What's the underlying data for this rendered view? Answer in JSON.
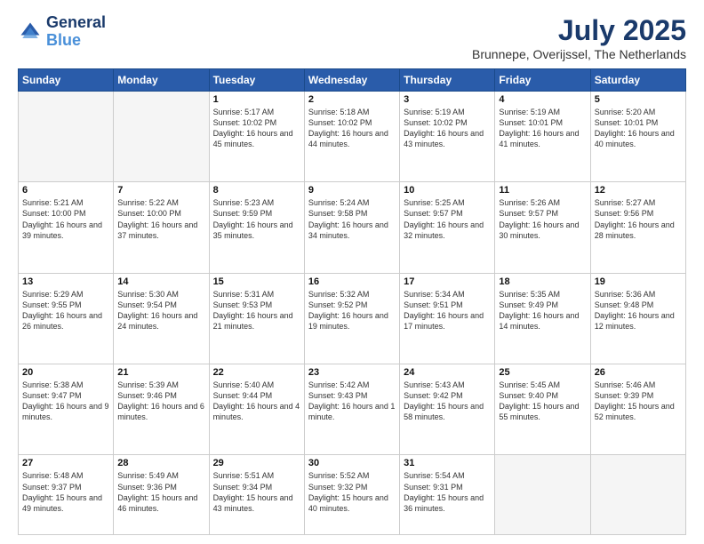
{
  "logo": {
    "line1": "General",
    "line2": "Blue"
  },
  "header": {
    "month": "July 2025",
    "location": "Brunnepe, Overijssel, The Netherlands"
  },
  "weekdays": [
    "Sunday",
    "Monday",
    "Tuesday",
    "Wednesday",
    "Thursday",
    "Friday",
    "Saturday"
  ],
  "weeks": [
    [
      {
        "day": "",
        "info": "",
        "empty": true
      },
      {
        "day": "",
        "info": "",
        "empty": true
      },
      {
        "day": "1",
        "info": "Sunrise: 5:17 AM\nSunset: 10:02 PM\nDaylight: 16 hours\nand 45 minutes."
      },
      {
        "day": "2",
        "info": "Sunrise: 5:18 AM\nSunset: 10:02 PM\nDaylight: 16 hours\nand 44 minutes."
      },
      {
        "day": "3",
        "info": "Sunrise: 5:19 AM\nSunset: 10:02 PM\nDaylight: 16 hours\nand 43 minutes."
      },
      {
        "day": "4",
        "info": "Sunrise: 5:19 AM\nSunset: 10:01 PM\nDaylight: 16 hours\nand 41 minutes."
      },
      {
        "day": "5",
        "info": "Sunrise: 5:20 AM\nSunset: 10:01 PM\nDaylight: 16 hours\nand 40 minutes."
      }
    ],
    [
      {
        "day": "6",
        "info": "Sunrise: 5:21 AM\nSunset: 10:00 PM\nDaylight: 16 hours\nand 39 minutes."
      },
      {
        "day": "7",
        "info": "Sunrise: 5:22 AM\nSunset: 10:00 PM\nDaylight: 16 hours\nand 37 minutes."
      },
      {
        "day": "8",
        "info": "Sunrise: 5:23 AM\nSunset: 9:59 PM\nDaylight: 16 hours\nand 35 minutes."
      },
      {
        "day": "9",
        "info": "Sunrise: 5:24 AM\nSunset: 9:58 PM\nDaylight: 16 hours\nand 34 minutes."
      },
      {
        "day": "10",
        "info": "Sunrise: 5:25 AM\nSunset: 9:57 PM\nDaylight: 16 hours\nand 32 minutes."
      },
      {
        "day": "11",
        "info": "Sunrise: 5:26 AM\nSunset: 9:57 PM\nDaylight: 16 hours\nand 30 minutes."
      },
      {
        "day": "12",
        "info": "Sunrise: 5:27 AM\nSunset: 9:56 PM\nDaylight: 16 hours\nand 28 minutes."
      }
    ],
    [
      {
        "day": "13",
        "info": "Sunrise: 5:29 AM\nSunset: 9:55 PM\nDaylight: 16 hours\nand 26 minutes."
      },
      {
        "day": "14",
        "info": "Sunrise: 5:30 AM\nSunset: 9:54 PM\nDaylight: 16 hours\nand 24 minutes."
      },
      {
        "day": "15",
        "info": "Sunrise: 5:31 AM\nSunset: 9:53 PM\nDaylight: 16 hours\nand 21 minutes."
      },
      {
        "day": "16",
        "info": "Sunrise: 5:32 AM\nSunset: 9:52 PM\nDaylight: 16 hours\nand 19 minutes."
      },
      {
        "day": "17",
        "info": "Sunrise: 5:34 AM\nSunset: 9:51 PM\nDaylight: 16 hours\nand 17 minutes."
      },
      {
        "day": "18",
        "info": "Sunrise: 5:35 AM\nSunset: 9:49 PM\nDaylight: 16 hours\nand 14 minutes."
      },
      {
        "day": "19",
        "info": "Sunrise: 5:36 AM\nSunset: 9:48 PM\nDaylight: 16 hours\nand 12 minutes."
      }
    ],
    [
      {
        "day": "20",
        "info": "Sunrise: 5:38 AM\nSunset: 9:47 PM\nDaylight: 16 hours\nand 9 minutes."
      },
      {
        "day": "21",
        "info": "Sunrise: 5:39 AM\nSunset: 9:46 PM\nDaylight: 16 hours\nand 6 minutes."
      },
      {
        "day": "22",
        "info": "Sunrise: 5:40 AM\nSunset: 9:44 PM\nDaylight: 16 hours\nand 4 minutes."
      },
      {
        "day": "23",
        "info": "Sunrise: 5:42 AM\nSunset: 9:43 PM\nDaylight: 16 hours\nand 1 minute."
      },
      {
        "day": "24",
        "info": "Sunrise: 5:43 AM\nSunset: 9:42 PM\nDaylight: 15 hours\nand 58 minutes."
      },
      {
        "day": "25",
        "info": "Sunrise: 5:45 AM\nSunset: 9:40 PM\nDaylight: 15 hours\nand 55 minutes."
      },
      {
        "day": "26",
        "info": "Sunrise: 5:46 AM\nSunset: 9:39 PM\nDaylight: 15 hours\nand 52 minutes."
      }
    ],
    [
      {
        "day": "27",
        "info": "Sunrise: 5:48 AM\nSunset: 9:37 PM\nDaylight: 15 hours\nand 49 minutes."
      },
      {
        "day": "28",
        "info": "Sunrise: 5:49 AM\nSunset: 9:36 PM\nDaylight: 15 hours\nand 46 minutes."
      },
      {
        "day": "29",
        "info": "Sunrise: 5:51 AM\nSunset: 9:34 PM\nDaylight: 15 hours\nand 43 minutes."
      },
      {
        "day": "30",
        "info": "Sunrise: 5:52 AM\nSunset: 9:32 PM\nDaylight: 15 hours\nand 40 minutes."
      },
      {
        "day": "31",
        "info": "Sunrise: 5:54 AM\nSunset: 9:31 PM\nDaylight: 15 hours\nand 36 minutes."
      },
      {
        "day": "",
        "info": "",
        "empty": true
      },
      {
        "day": "",
        "info": "",
        "empty": true
      }
    ]
  ]
}
